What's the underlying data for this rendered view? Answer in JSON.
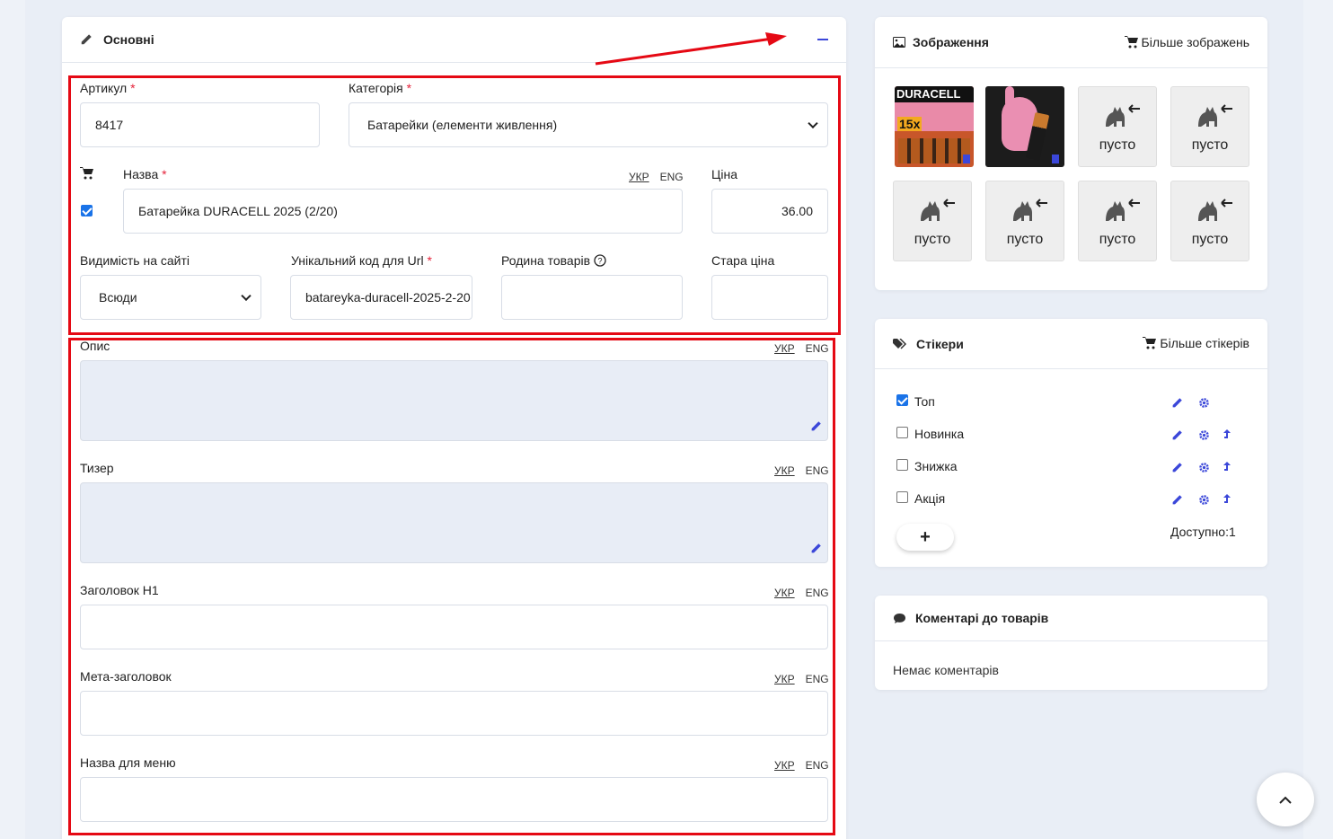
{
  "main": {
    "title": "Основні",
    "fields": {
      "sku_label": "Артикул",
      "sku_value": "8417",
      "category_label": "Категорія",
      "category_value": "Батарейки (елементи живлення)",
      "name_label": "Назва",
      "name_value": "Батарейка DURACELL 2025 (2/20)",
      "price_label": "Ціна",
      "price_value": "36.00",
      "visibility_label": "Видимість на сайті",
      "visibility_value": "Всюди",
      "url_label": "Унікальний код для Url",
      "url_value": "batareyka-duracell-2025-2-20",
      "family_label": "Родина товарів",
      "old_price_label": "Стара ціна",
      "description_label": "Опис",
      "teaser_label": "Тизер",
      "h1_label": "Заголовок H1",
      "meta_title_label": "Мета-заголовок",
      "menu_name_label": "Назва для меню"
    },
    "lang": {
      "ukr": "УКР",
      "eng": "ENG"
    },
    "required_mark": "*"
  },
  "images": {
    "title": "Зображення",
    "more_label": "Більше зображень",
    "thumb1_brand": "DURACELL",
    "thumb1_badge": "15x",
    "empty_label": "пусто"
  },
  "stickers": {
    "title": "Стікери",
    "more_label": "Більше стікерів",
    "items": [
      {
        "label": "Топ",
        "checked": true
      },
      {
        "label": "Новинка",
        "checked": false
      },
      {
        "label": "Знижка",
        "checked": false
      },
      {
        "label": "Акція",
        "checked": false
      }
    ],
    "add_label": "+",
    "available_label": "Доступно:1"
  },
  "comments": {
    "title": "Коментарі до товарів",
    "empty_text": "Немає коментарів"
  },
  "colors": {
    "accent": "#3b47d9",
    "highlight": "#e50914",
    "checkbox": "#1a73e8"
  }
}
